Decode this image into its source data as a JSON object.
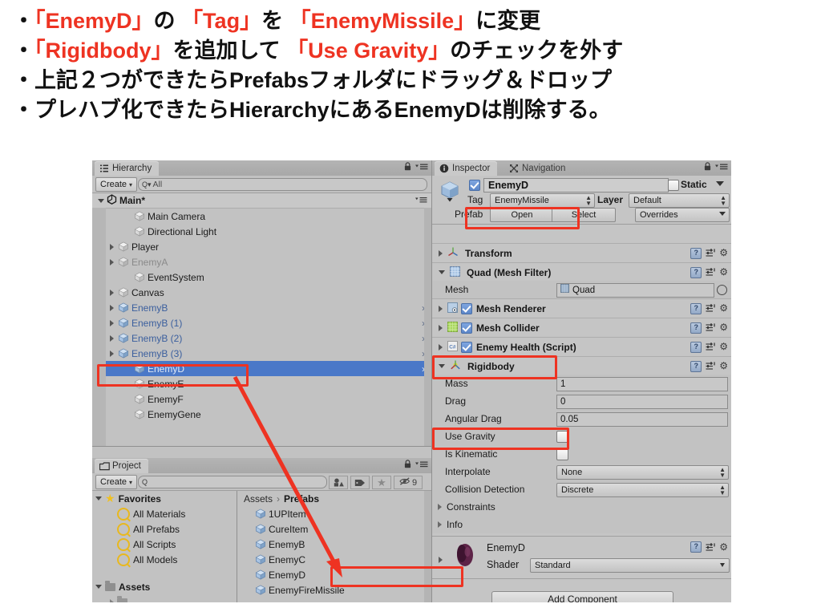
{
  "slide": {
    "bullets": [
      [
        {
          "t": "・",
          "c": "dark"
        },
        {
          "t": "「EnemyD」",
          "c": "red"
        },
        {
          "t": "の ",
          "c": "dark"
        },
        {
          "t": "「Tag」",
          "c": "red"
        },
        {
          "t": "を ",
          "c": "dark"
        },
        {
          "t": "「EnemyMissile」",
          "c": "red"
        },
        {
          "t": "に変更",
          "c": "dark"
        }
      ],
      [
        {
          "t": "・",
          "c": "dark"
        },
        {
          "t": "「Rigidbody」",
          "c": "red"
        },
        {
          "t": "を追加して ",
          "c": "dark"
        },
        {
          "t": "「Use Gravity」",
          "c": "red"
        },
        {
          "t": "のチェックを外す",
          "c": "dark"
        }
      ],
      [
        {
          "t": "・上記２つができたらPrefabsフォルダにドラッグ＆ドロップ",
          "c": "dark"
        }
      ],
      [
        {
          "t": "・プレハブ化できたらHierarchyにあるEnemyDは削除する。",
          "c": "dark"
        }
      ]
    ],
    "highlight_color": "#ee3322",
    "text_color": "#111111"
  },
  "hierarchy": {
    "tab_label": "Hierarchy",
    "create_label": "Create",
    "search_placeholder": "All",
    "search_value": "",
    "scene_name": "Main*",
    "rows": [
      {
        "label": "Main Camera",
        "indent": 2,
        "arrow": false,
        "style": "normal",
        "chevron": false
      },
      {
        "label": "Directional Light",
        "indent": 2,
        "arrow": false,
        "style": "normal",
        "chevron": false
      },
      {
        "label": "Player",
        "indent": 1,
        "arrow": true,
        "style": "normal",
        "chevron": false
      },
      {
        "label": "EnemyA",
        "indent": 1,
        "arrow": true,
        "style": "grey",
        "chevron": false
      },
      {
        "label": "EventSystem",
        "indent": 2,
        "arrow": false,
        "style": "normal",
        "chevron": false
      },
      {
        "label": "Canvas",
        "indent": 1,
        "arrow": true,
        "style": "normal",
        "chevron": false
      },
      {
        "label": "EnemyB",
        "indent": 1,
        "arrow": true,
        "style": "blue",
        "chevron": true
      },
      {
        "label": "EnemyB (1)",
        "indent": 1,
        "arrow": true,
        "style": "blue",
        "chevron": true
      },
      {
        "label": "EnemyB (2)",
        "indent": 1,
        "arrow": true,
        "style": "blue",
        "chevron": true
      },
      {
        "label": "EnemyB (3)",
        "indent": 1,
        "arrow": true,
        "style": "blue",
        "chevron": true
      },
      {
        "label": "EnemyD",
        "indent": 2,
        "arrow": false,
        "style": "blue",
        "chevron": true,
        "selected": true
      },
      {
        "label": "EnemyE",
        "indent": 2,
        "arrow": false,
        "style": "normal",
        "chevron": false
      },
      {
        "label": "EnemyF",
        "indent": 2,
        "arrow": false,
        "style": "normal",
        "chevron": false
      },
      {
        "label": "EnemyGene",
        "indent": 2,
        "arrow": false,
        "style": "normal",
        "chevron": false
      }
    ]
  },
  "inspector": {
    "tab_label": "Inspector",
    "nav_tab_label": "Navigation",
    "object_name": "EnemyD",
    "object_enabled": true,
    "static_label": "Static",
    "static_checked": false,
    "tag_label": "Tag",
    "tag_value": "EnemyMissile",
    "layer_label": "Layer",
    "layer_value": "Default",
    "prefab_label": "Prefab",
    "prefab_open": "Open",
    "prefab_select": "Select",
    "prefab_overrides": "Overrides",
    "components": [
      {
        "name": "Transform",
        "expanded": false,
        "checkbox": null,
        "icon": "transform-icon"
      },
      {
        "name": "Quad (Mesh Filter)",
        "expanded": true,
        "checkbox": null,
        "icon": "mesh-filter-icon"
      },
      {
        "name": "Mesh Renderer",
        "expanded": false,
        "checkbox": true,
        "icon": "mesh-renderer-icon"
      },
      {
        "name": "Mesh Collider",
        "expanded": false,
        "checkbox": true,
        "icon": "mesh-collider-icon"
      },
      {
        "name": "Enemy Health (Script)",
        "expanded": false,
        "checkbox": true,
        "icon": "script-icon"
      },
      {
        "name": "Rigidbody",
        "expanded": true,
        "checkbox": null,
        "icon": "rigidbody-icon"
      }
    ],
    "mesh_label": "Mesh",
    "mesh_value": "Quad",
    "rigidbody": {
      "mass_label": "Mass",
      "mass_value": "1",
      "drag_label": "Drag",
      "drag_value": "0",
      "angular_drag_label": "Angular Drag",
      "angular_drag_value": "0.05",
      "use_gravity_label": "Use Gravity",
      "use_gravity_checked": false,
      "is_kinematic_label": "Is Kinematic",
      "is_kinematic_checked": false,
      "interpolate_label": "Interpolate",
      "interpolate_value": "None",
      "collision_detection_label": "Collision Detection",
      "collision_detection_value": "Discrete",
      "constraints_label": "Constraints",
      "info_label": "Info"
    },
    "material": {
      "name": "EnemyD",
      "shader_label": "Shader",
      "shader_value": "Standard"
    },
    "add_component_label": "Add Component"
  },
  "project": {
    "tab_label": "Project",
    "create_label": "Create",
    "search_value": "",
    "hidden_count": "9",
    "favorites_label": "Favorites",
    "favorites": [
      {
        "label": "All Materials"
      },
      {
        "label": "All Prefabs"
      },
      {
        "label": "All Scripts"
      },
      {
        "label": "All Models"
      }
    ],
    "assets_label": "Assets",
    "breadcrumb_root": "Assets",
    "breadcrumb_current": "Prefabs",
    "items": [
      {
        "label": "1UPItem"
      },
      {
        "label": "CureItem"
      },
      {
        "label": "EnemyB"
      },
      {
        "label": "EnemyC"
      },
      {
        "label": "EnemyD",
        "highlighted": true
      },
      {
        "label": "EnemyFireMissile"
      }
    ]
  },
  "annotations": {
    "box_color": "#ee3322",
    "arrow_color": "#ee3322"
  }
}
